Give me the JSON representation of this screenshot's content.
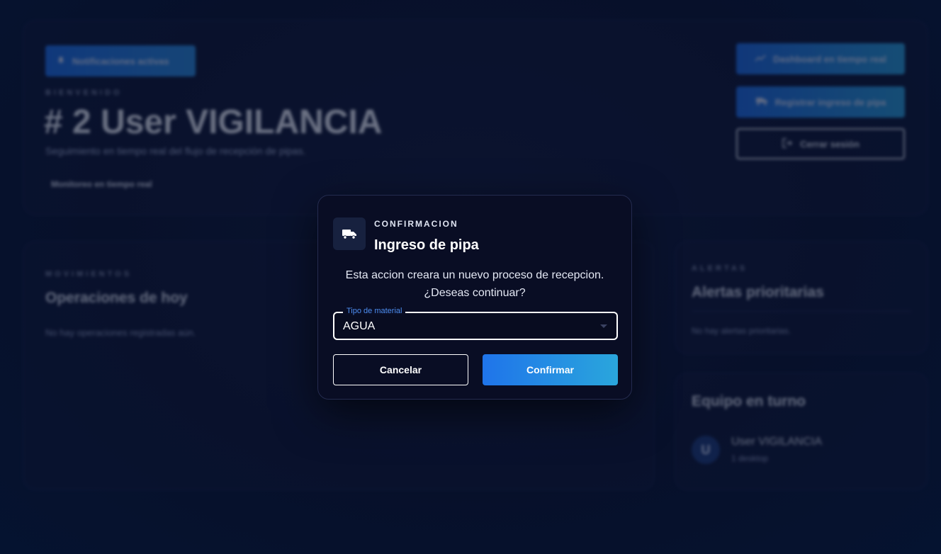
{
  "header": {
    "notifications_label": "Notificaciones activas",
    "welcome_eyebrow": "BIENVENIDO",
    "title": "# 2 User VIGILANCIA",
    "subtitle": "Seguimiento en tiempo real del flujo de recepción de pipas.",
    "monitor_chip": "Monitoreo en tiempo real",
    "dashboard_button": "Dashboard en tiempo real",
    "register_button": "Registrar ingreso de pipa",
    "logout_button": "Cerrar sesión"
  },
  "operations": {
    "eyebrow": "MOVIMIENTOS",
    "title": "Operaciones de hoy",
    "empty": "No hay operaciones registradas aún."
  },
  "alerts": {
    "eyebrow": "ALERTAS",
    "title": "Alertas prioritarias",
    "empty": "No hay alertas prioritarias."
  },
  "team": {
    "title": "Equipo en turno",
    "members": [
      {
        "initial": "U",
        "name": "User VIGILANCIA",
        "meta": "1 desktop"
      }
    ]
  },
  "modal": {
    "eyebrow": "CONFIRMACION",
    "title": "Ingreso de pipa",
    "message_line1": "Esta accion creara un nuevo proceso de recepcion.",
    "message_line2": "¿Deseas continuar?",
    "field_label": "Tipo de material",
    "field_value": "AGUA",
    "cancel_label": "Cancelar",
    "confirm_label": "Confirmar"
  },
  "colors": {
    "accent": "#1f74ea",
    "accent_end": "#2aa6dc",
    "field_label": "#4d8ef0",
    "background": "#07102a"
  },
  "icons": {
    "modal": "truck-icon",
    "notifications": "bell-icon",
    "dashboard": "trend-line-icon",
    "register": "truck-icon",
    "logout": "logout-icon"
  }
}
